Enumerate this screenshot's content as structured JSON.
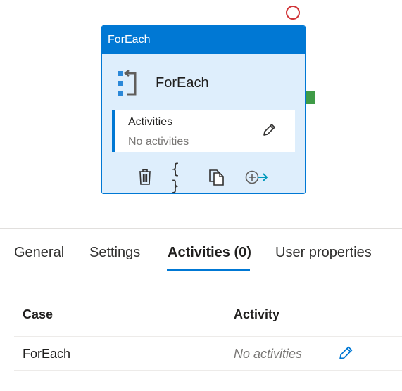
{
  "node": {
    "header": "ForEach",
    "title": "ForEach",
    "activities_label": "Activities",
    "activities_value": "No activities",
    "code_icon_text": "{ }"
  },
  "tabs": [
    {
      "label": "General"
    },
    {
      "label": "Settings"
    },
    {
      "label": "Activities (0)",
      "selected": true
    },
    {
      "label": "User properties"
    }
  ],
  "table": {
    "columns": [
      "Case",
      "Activity"
    ],
    "rows": [
      {
        "case": "ForEach",
        "activity": "No activities"
      }
    ]
  },
  "colors": {
    "accent": "#0078d4",
    "node_bg": "#deeefc",
    "status_circle": "#d13438",
    "success_port": "#3f9b47"
  }
}
